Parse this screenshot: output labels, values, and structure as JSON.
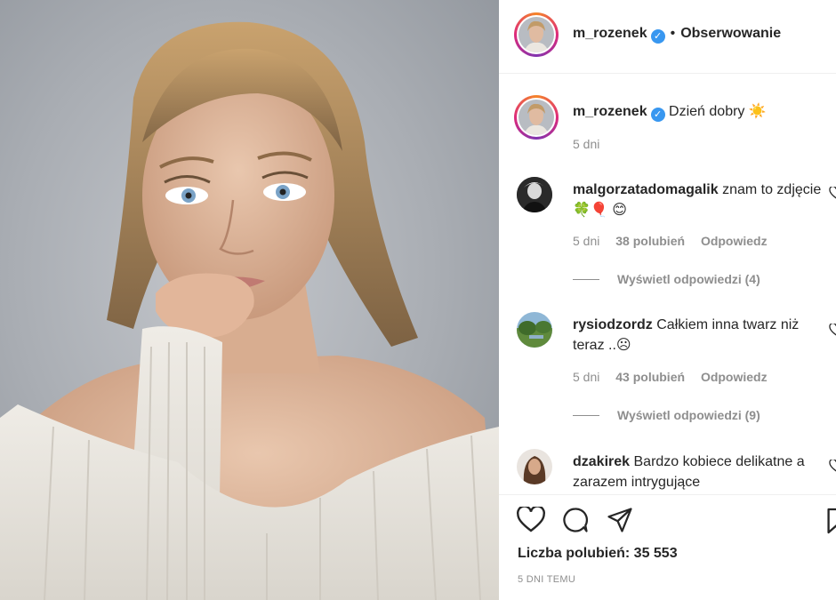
{
  "header": {
    "username": "m_rozenek",
    "follow_label": "Obserwowanie"
  },
  "caption": {
    "username": "m_rozenek",
    "text": "Dzień dobry",
    "emoji": "☀️",
    "time": "5 dni"
  },
  "comments": [
    {
      "username": "malgorzatadomagalik",
      "text": "znam to zdjęcie 🍀🎈 😊",
      "time": "5 dni",
      "likes": "38 polubień",
      "reply_label": "Odpowiedz",
      "view_replies": "Wyświetl odpowiedzi (4)"
    },
    {
      "username": "rysiodzordz",
      "text": "Całkiem inna twarz niż teraz ..☹",
      "time": "5 dni",
      "likes": "43 polubień",
      "reply_label": "Odpowiedz",
      "view_replies": "Wyświetl odpowiedzi (9)"
    },
    {
      "username": "dzakirek",
      "text": "Bardzo kobiece delikatne a zarazem intrygujące"
    }
  ],
  "footer": {
    "likes_text": "Liczba polubień: 35 553",
    "timestamp": "5 DNI TEMU"
  },
  "icons": {
    "like": "heart-icon",
    "comment": "comment-icon",
    "share": "share-icon",
    "save": "bookmark-icon",
    "verified": "verified-badge-icon"
  },
  "colors": {
    "verified": "#3897f0",
    "text": "#262626",
    "muted": "#8e8e8e"
  }
}
